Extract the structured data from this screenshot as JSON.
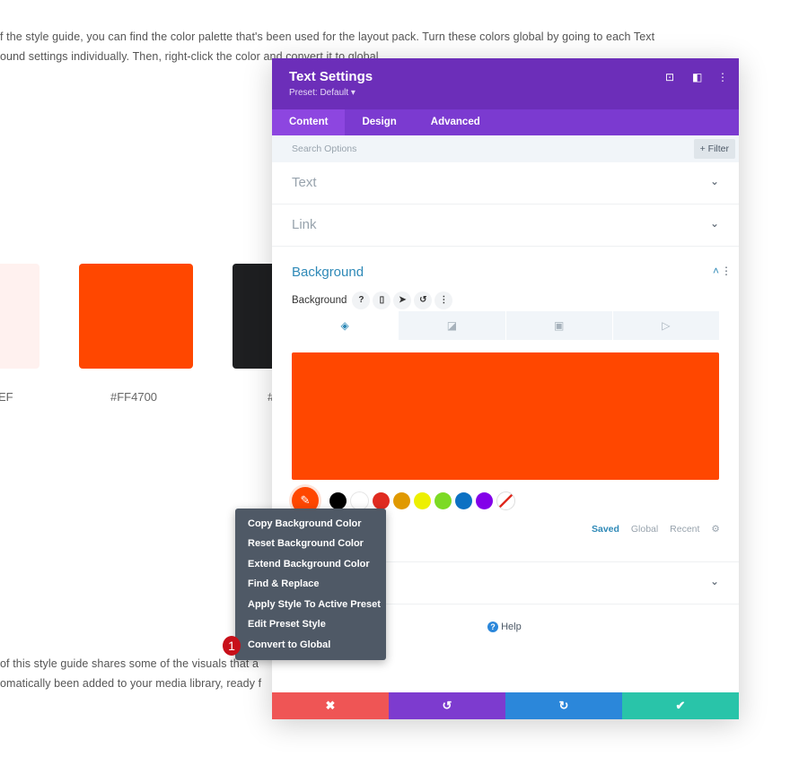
{
  "page": {
    "line1": "f the style guide, you can find the color palette that's been used for the layout pack. Turn these colors global by going to each Text",
    "line2": "ound settings individually. Then, right-click the color and convert it to global.",
    "line3": "of this style guide shares some of the visuals that a",
    "line4": "omatically been added to your media library, ready f",
    "swatches": [
      {
        "label": "EF",
        "color": "#FFF1EF"
      },
      {
        "label": "#FF4700",
        "color": "#FF4700"
      },
      {
        "label": "#",
        "color": "#1e1f21"
      }
    ]
  },
  "modal": {
    "title": "Text Settings",
    "preset": "Preset: Default ▾",
    "tabs": [
      "Content",
      "Design",
      "Advanced"
    ],
    "search_placeholder": "Search Options",
    "filter": "+ Filter",
    "sections": {
      "text": "Text",
      "link": "Link",
      "background": "Background"
    },
    "bg_label": "Background",
    "bg_color": "#FF4700",
    "palette": [
      "#000000",
      "#ffffff",
      "#e02b20",
      "#e09900",
      "#edf000",
      "#7cda24",
      "#0c71c3",
      "#8300e9"
    ],
    "palette_tabs": [
      "Saved",
      "Global",
      "Recent"
    ],
    "help": "Help"
  },
  "context_menu": {
    "items": [
      "Copy Background Color",
      "Reset Background Color",
      "Extend Background Color",
      "Find & Replace",
      "Apply Style To Active Preset",
      "Edit Preset Style",
      "Convert to Global"
    ],
    "badge": "1"
  },
  "footer": {
    "cancel": "✖",
    "undo": "↺",
    "redo": "↻",
    "save": "✔"
  }
}
